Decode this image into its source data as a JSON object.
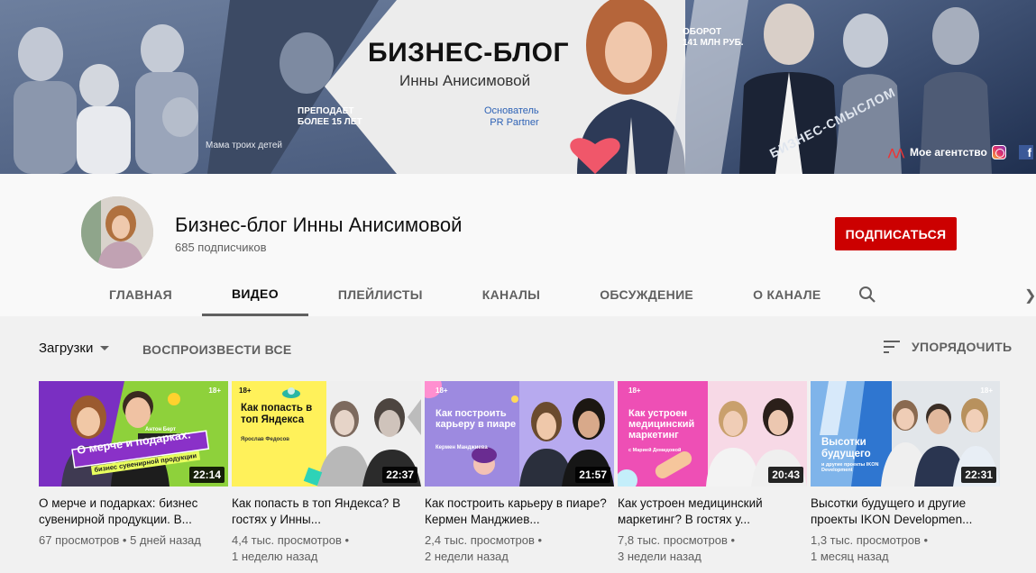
{
  "banner": {
    "title": "БИЗНЕС-БЛОГ",
    "subtitle": "Инны Анисимовой",
    "founder_line1": "Основатель",
    "founder_line2": "PR Partner",
    "sells_line1": "ПРЕПОДАЕТ",
    "sells_line2": "БОЛЕЕ 15 ЛЕТ",
    "turnover_line1": "ОБОРОТ",
    "turnover_line2": "141 МЛН РУБ.",
    "mama": "Мама троих детей",
    "agency": "Мое агентство",
    "sign": "БИЗНЕС-СМЫСЛОМ",
    "instagram_icon": "instagram-icon",
    "facebook_icon": "facebook-icon",
    "facebook_letter": "f"
  },
  "channel": {
    "name": "Бизнес-блог Инны Анисимовой",
    "subscribers": "685 подписчиков",
    "subscribe_label": "ПОДПИСАТЬСЯ"
  },
  "tabs": [
    {
      "label": "ГЛАВНАЯ"
    },
    {
      "label": "ВИДЕО"
    },
    {
      "label": "ПЛЕЙЛИСТЫ"
    },
    {
      "label": "КАНАЛЫ"
    },
    {
      "label": "ОБСУЖДЕНИЕ"
    },
    {
      "label": "О КАНАЛЕ"
    }
  ],
  "toolbar": {
    "uploads_label": "Загрузки",
    "play_all_label": "ВОСПРОИЗВЕСТИ ВСЕ",
    "sort_label": "УПОРЯДОЧИТЬ"
  },
  "videos": [
    {
      "title": "О мерче и подарках: бизнес сувенирной продукции. В...",
      "duration": "22:14",
      "views": "67 просмотров",
      "age": "5 дней назад",
      "thumb_text": "О мерче и подарках:",
      "thumb_sub": "бизнес сувенирной продукции",
      "thumb_guest": "Антон Берт"
    },
    {
      "title": "Как попасть в топ Яндекса? В гостях у Инны...",
      "duration": "22:37",
      "views": "4,4 тыс. просмотров",
      "age": "1 неделю назад",
      "thumb_text": "Как попасть в топ Яндекса",
      "thumb_sub": "Ярослав Федосов"
    },
    {
      "title": "Как построить карьеру в пиаре? Кермен Манджиев...",
      "duration": "21:57",
      "views": "2,4 тыс. просмотров",
      "age": "2 недели назад",
      "thumb_text": "Как построить карьеру в пиаре",
      "thumb_sub": "Кермен Манджиева"
    },
    {
      "title": "Как устроен медицинский маркетинг? В гостях у...",
      "duration": "20:43",
      "views": "7,8 тыс. просмотров",
      "age": "3 недели назад",
      "thumb_text": "Как устроен медицинский маркетинг",
      "thumb_sub": "с Марией Демидовой"
    },
    {
      "title": "Высотки будущего и другие проекты IKON Developmen...",
      "duration": "22:31",
      "views": "1,3 тыс. просмотров",
      "age": "1 месяц назад",
      "thumb_text": "Высотки будущего",
      "thumb_sub": "и другие проекты IKON Development"
    }
  ],
  "badge_18": "18+",
  "meta_sep": "•"
}
